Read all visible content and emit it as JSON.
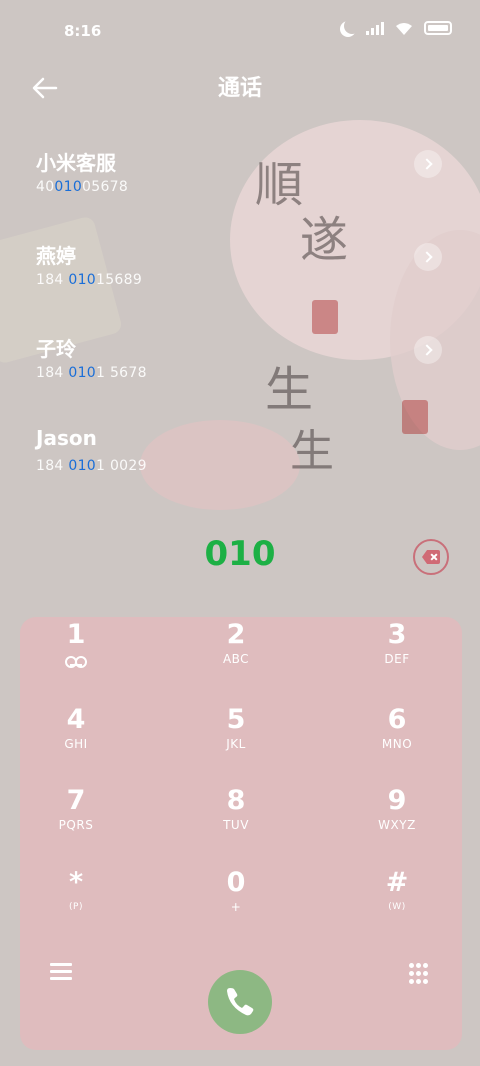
{
  "status_bar": {
    "time": "8:16",
    "icons": [
      "moon-icon",
      "signal-icon",
      "wifi-icon",
      "battery-icon"
    ]
  },
  "header": {
    "title": "通话",
    "back_icon": "arrow-left-icon"
  },
  "search_results": [
    {
      "name": "小米客服",
      "number_prefix": "40",
      "number_match": "010",
      "number_suffix": "05678"
    },
    {
      "name": "燕婷",
      "number_prefix": "184 ",
      "number_match": "010",
      "number_suffix": "15689"
    },
    {
      "name": "子玲",
      "number_prefix": "184 ",
      "number_match": "010",
      "number_suffix": "1 5678"
    },
    {
      "name": "Jason",
      "number_prefix": "184 ",
      "number_match": "010",
      "number_suffix": "1 0029"
    }
  ],
  "dial": {
    "input": "010",
    "backspace_icon": "backspace-icon"
  },
  "keypad": [
    {
      "digit": "1",
      "sub": "",
      "sub_icon": "voicemail-icon"
    },
    {
      "digit": "2",
      "sub": "ABC"
    },
    {
      "digit": "3",
      "sub": "DEF"
    },
    {
      "digit": "4",
      "sub": "GHI"
    },
    {
      "digit": "5",
      "sub": "JKL"
    },
    {
      "digit": "6",
      "sub": "MNO"
    },
    {
      "digit": "7",
      "sub": "PQRS"
    },
    {
      "digit": "8",
      "sub": "TUV"
    },
    {
      "digit": "9",
      "sub": "WXYZ"
    },
    {
      "digit": "*",
      "sub": "(P)"
    },
    {
      "digit": "0",
      "sub": "+"
    },
    {
      "digit": "#",
      "sub": "(W)"
    }
  ],
  "bottom_bar": {
    "menu_icon": "menu-icon",
    "call_icon": "phone-icon",
    "keypad_icon": "dialpad-icon"
  },
  "colors": {
    "match_highlight": "#1a6ed8",
    "dialed_text": "#1db045",
    "call_button": "#8db883",
    "backspace": "#d06a75"
  }
}
